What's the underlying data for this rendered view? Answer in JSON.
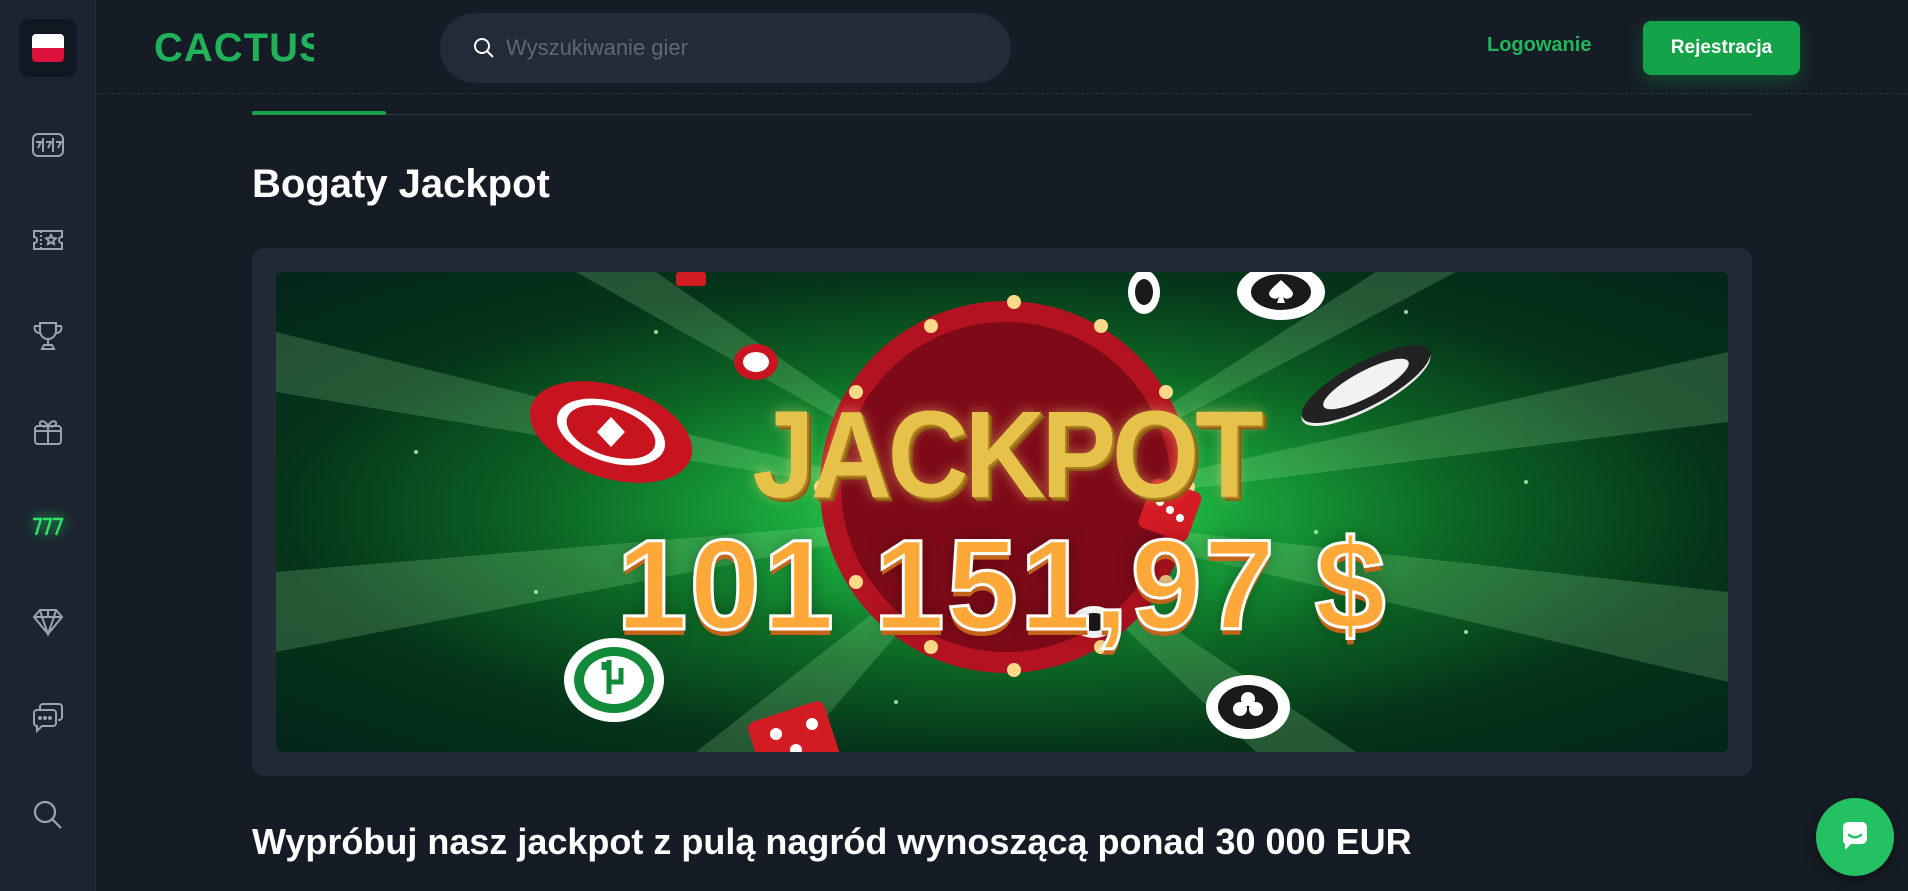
{
  "sidebar": {
    "language_flag": "poland-flag",
    "items": [
      {
        "name": "slots",
        "icon": "slot-machine-icon"
      },
      {
        "name": "live-casino",
        "icon": "ticket-star-icon"
      },
      {
        "name": "tournaments",
        "icon": "trophy-icon"
      },
      {
        "name": "promotions",
        "icon": "gift-box-icon"
      },
      {
        "name": "jackpot",
        "icon": "sevens-icon",
        "active": true
      },
      {
        "name": "vip",
        "icon": "diamond-icon"
      },
      {
        "name": "support",
        "icon": "chat-bubbles-icon"
      },
      {
        "name": "search",
        "icon": "search-icon"
      }
    ]
  },
  "header": {
    "logo_text": "CACTUS",
    "search_placeholder": "Wyszukiwanie gier",
    "login_label": "Logowanie",
    "register_label": "Rejestracja"
  },
  "main": {
    "title": "Bogaty Jackpot",
    "banner": {
      "word": "JACKPOT",
      "amount": "101 151,97 $"
    },
    "subtitle": "Wypróbuj nasz jackpot z pulą nagród wynoszącą ponad 30 000 EUR"
  },
  "colors": {
    "accent": "#15a34a",
    "background": "#161c25",
    "sidebar": "#1c2430"
  }
}
